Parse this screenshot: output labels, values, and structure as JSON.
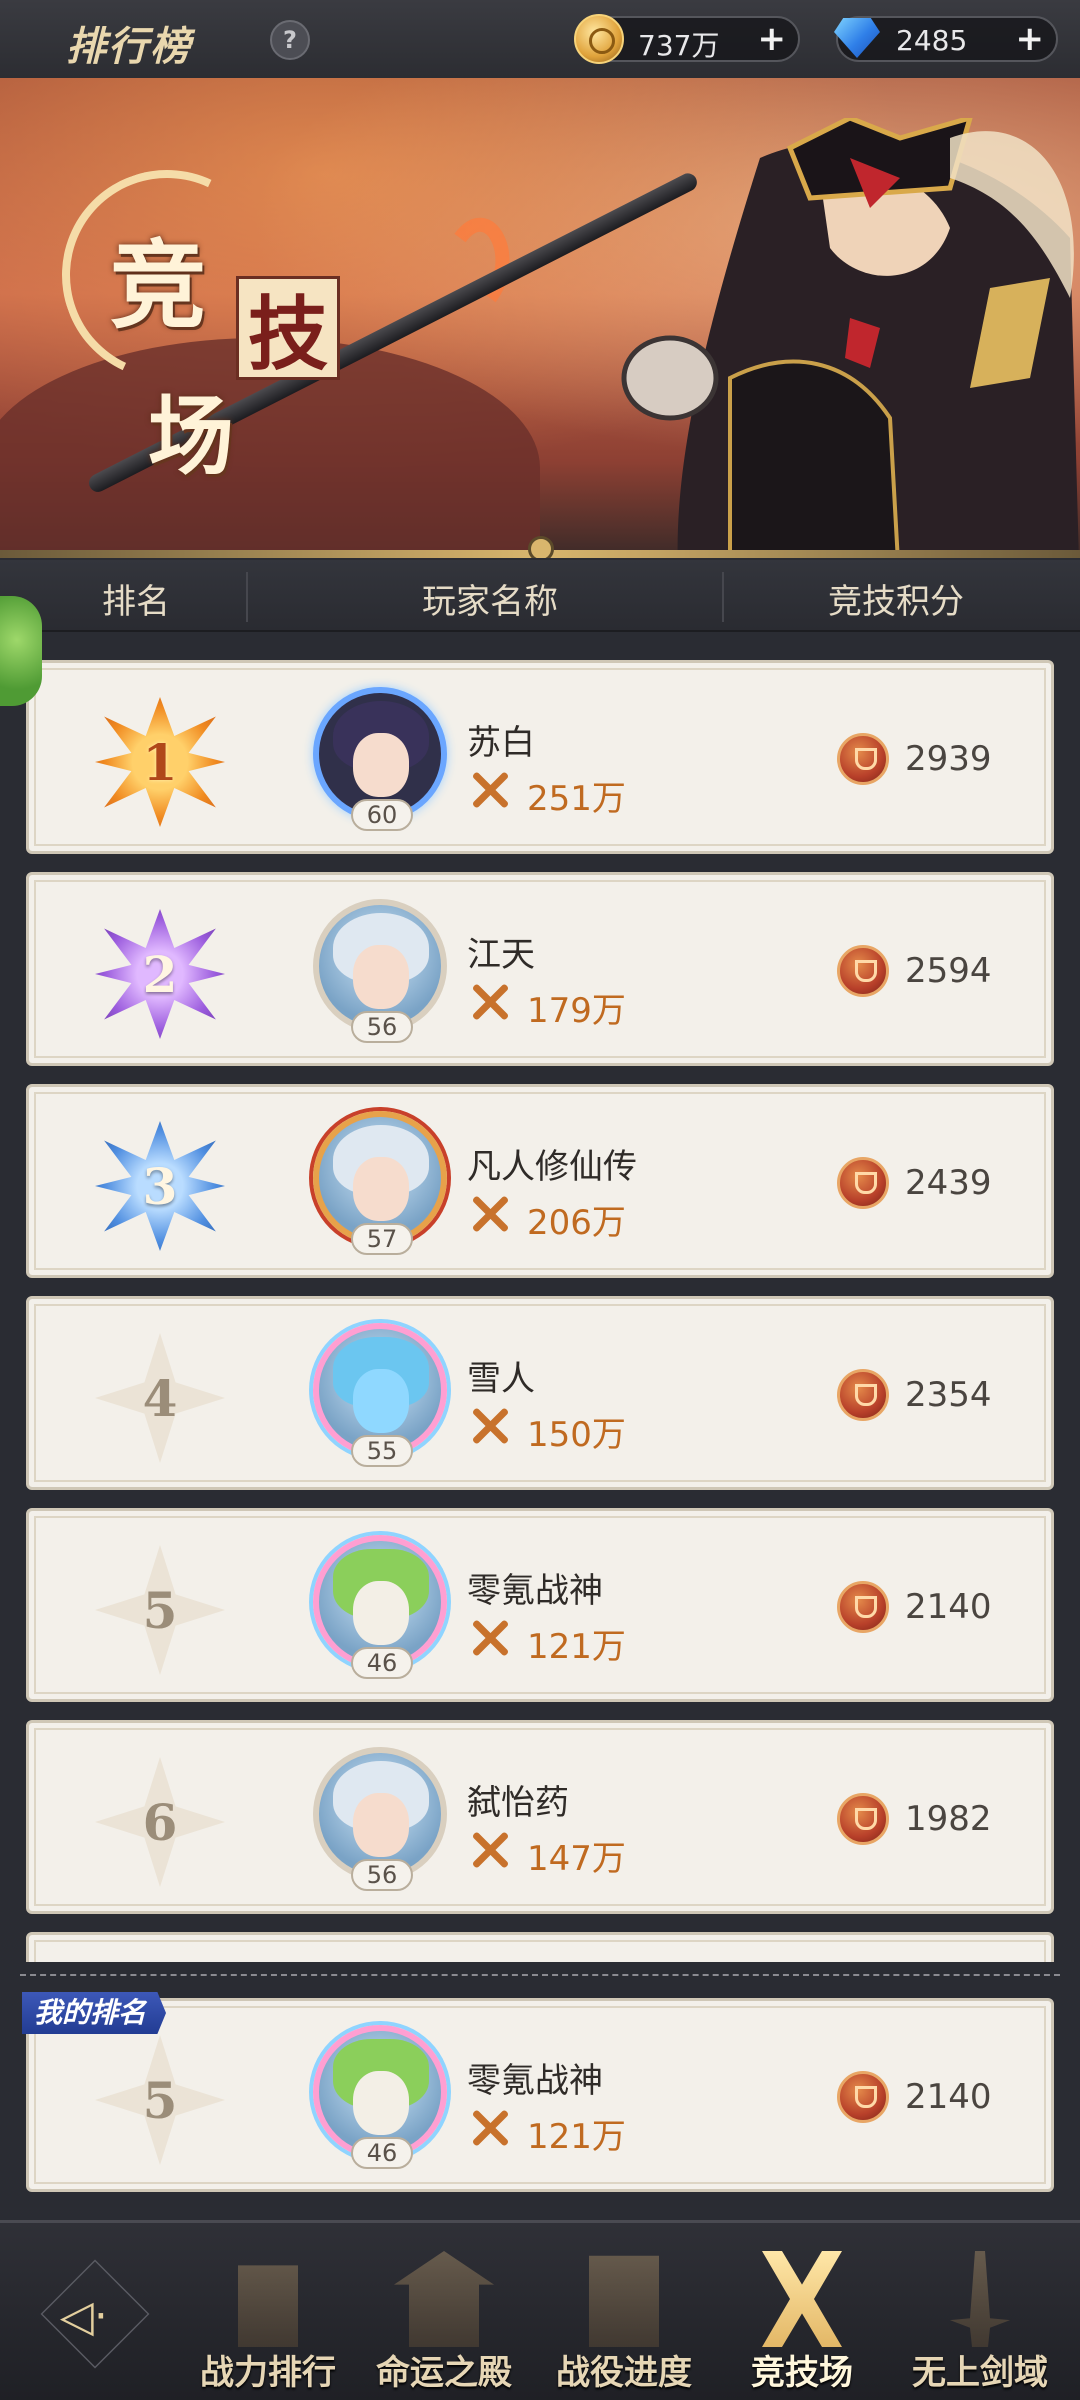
{
  "header": {
    "title": "排行榜",
    "help_icon": "?"
  },
  "resources": {
    "gold": "737万",
    "gems": "2485",
    "plus": "+"
  },
  "banner": {
    "title_char1": "竞",
    "title_char2": "技",
    "title_char3": "场"
  },
  "columns": {
    "rank": "排名",
    "player": "玩家名称",
    "score": "竞技积分"
  },
  "rows": [
    {
      "rank": "1",
      "name": "苏白",
      "level": "60",
      "power": "251万",
      "score": "2939"
    },
    {
      "rank": "2",
      "name": "江天",
      "level": "56",
      "power": "179万",
      "score": "2594"
    },
    {
      "rank": "3",
      "name": "凡人修仙传",
      "level": "57",
      "power": "206万",
      "score": "2439"
    },
    {
      "rank": "4",
      "name": "雪人",
      "level": "55",
      "power": "150万",
      "score": "2354"
    },
    {
      "rank": "5",
      "name": "零氪战神",
      "level": "46",
      "power": "121万",
      "score": "2140"
    },
    {
      "rank": "6",
      "name": "弑怡药",
      "level": "56",
      "power": "147万",
      "score": "1982"
    }
  ],
  "my_rank": {
    "tag": "我的排名",
    "rank": "5",
    "name": "零氪战神",
    "level": "46",
    "power": "121万",
    "score": "2140"
  },
  "nav": {
    "items": [
      "战力排行",
      "命运之殿",
      "战役进度",
      "竞技场",
      "无上剑域"
    ],
    "back_icon": "◁·"
  },
  "colors": {
    "accent": "#e3b766",
    "panel": "#f3f0ea",
    "power": "#c06a20"
  }
}
